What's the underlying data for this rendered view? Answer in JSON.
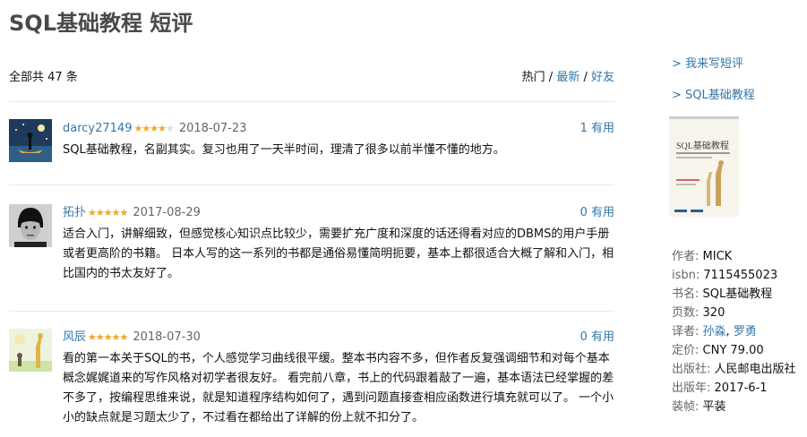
{
  "page": {
    "title": "SQL基础教程 短评"
  },
  "summary": {
    "total_text": "全部共 47 条",
    "sort_hot": "热门",
    "sort_new": "最新",
    "sort_friends": "好友",
    "sep": " / "
  },
  "comments": [
    {
      "user": "darcy27149",
      "rating": 4,
      "date": "2018-07-23",
      "votes": "1 有用",
      "text": "SQL基础教程，名副其实。复习也用了一天半时间，理清了很多以前半懂不懂的地方。"
    },
    {
      "user": "拓扑",
      "rating": 5,
      "date": "2017-08-29",
      "votes": "0 有用",
      "text": "适合入门，讲解细致，但感觉核心知识点比较少，需要扩充广度和深度的话还得看对应的DBMS的用户手册或者更高阶的书籍。 日本人写的这一系列的书都是通俗易懂简明扼要，基本上都很适合大概了解和入门，相比国内的书太友好了。"
    },
    {
      "user": "风辰",
      "rating": 5,
      "date": "2018-07-30",
      "votes": "0 有用",
      "text": "看的第一本关于SQL的书，个人感觉学习曲线很平缓。整本书内容不多，但作者反复强调细节和对每个基本概念娓娓道来的写作风格对初学者很友好。 看完前八章，书上的代码跟着敲了一遍，基本语法已经掌握的差不多了，按编程思维来说，就是知道程序结构如何了，遇到问题直接查相应函数进行填充就可以了。 一个小小的缺点就是习题太少了，不过看在都给出了详解的份上就不扣分了。"
    }
  ],
  "sidebar": {
    "write_link": "> 我来写短评",
    "book_link": "> SQL基础教程",
    "cover_text": "SQL基础教程"
  },
  "book_info": {
    "author_label": "作者:",
    "author": "MICK",
    "isbn_label": "isbn:",
    "isbn": "7115455023",
    "title_label": "书名:",
    "title": "SQL基础教程",
    "pages_label": "页数:",
    "pages": "320",
    "translator_label": "译者:",
    "translator1": "孙淼",
    "translator_sep": ", ",
    "translator2": "罗勇",
    "price_label": "定价:",
    "price": "CNY 79.00",
    "publisher_label": "出版社:",
    "publisher": "人民邮电出版社",
    "pubyear_label": "出版年:",
    "pubyear": "2017-6-1",
    "binding_label": "装帧:",
    "binding": "平装"
  },
  "colors": {
    "link": "#3377aa",
    "star": "#f5a623",
    "title": "#494949"
  }
}
